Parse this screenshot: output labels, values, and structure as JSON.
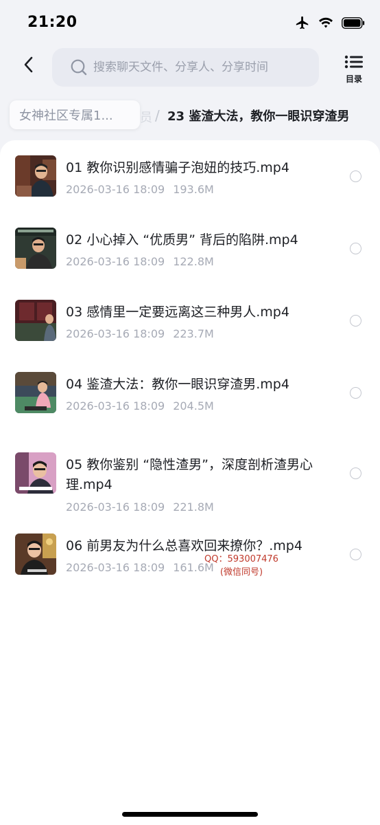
{
  "status_bar": {
    "time": "21:20",
    "icons": [
      "airplane-icon",
      "wifi-icon",
      "battery-icon"
    ]
  },
  "header": {
    "back_icon": "chevron-left-icon",
    "search": {
      "placeholder": "搜索聊天文件、分享人、分享时间",
      "value": "",
      "icon": "search-icon"
    },
    "toc": {
      "label": "目录",
      "icon": "list-icon"
    }
  },
  "breadcrumb": {
    "parent": "女神社区专属1...",
    "faded": "员",
    "separator": "/",
    "current": "23 鉴渣大法，教你一眼识穿渣男"
  },
  "files": [
    {
      "name": "01 教你识别感情骗子泡妞的技巧.mp4",
      "date": "2026-03-16 18:09",
      "size": "193.6M"
    },
    {
      "name": "02 小心掉入 “优质男” 背后的陷阱.mp4",
      "date": "2026-03-16 18:09",
      "size": "122.8M"
    },
    {
      "name": "03 感情里一定要远离这三种男人.mp4",
      "date": "2026-03-16 18:09",
      "size": "223.7M"
    },
    {
      "name": "04 鉴渣大法：教你一眼识穿渣男.mp4",
      "date": "2026-03-16 18:09",
      "size": "204.5M"
    },
    {
      "name": "05 教你鉴别 “隐性渣男”，深度剖析渣男心理.mp4",
      "date": "2026-03-16 18:09",
      "size": "221.8M"
    },
    {
      "name": "06 前男友为什么总喜欢回来撩你？.mp4",
      "date": "2026-03-16 18:09",
      "size": "161.6M"
    }
  ],
  "watermark": {
    "line1": "QQ：593007476",
    "line2": "(微信同号)"
  },
  "colors": {
    "background": "#f2f3f7",
    "search_bg": "#e8eaf1",
    "meta_text": "#a6aab5",
    "watermark": "#c0392b"
  }
}
